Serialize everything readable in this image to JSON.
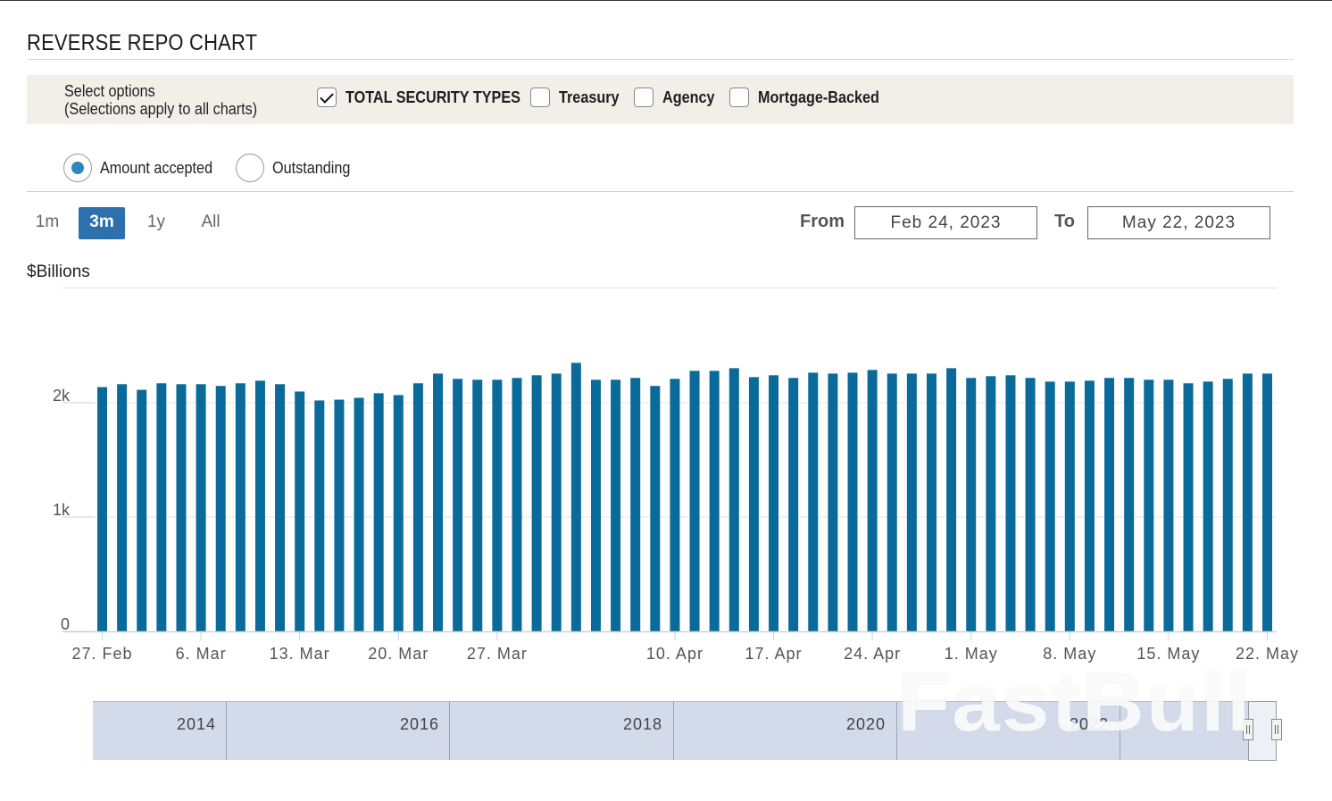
{
  "page": {
    "title": "REVERSE REPO CHART"
  },
  "options": {
    "label_line1": "Select options",
    "label_line2": "(Selections apply to all charts)",
    "checkboxes": [
      {
        "label": "TOTAL SECURITY TYPES",
        "checked": true
      },
      {
        "label": "Treasury",
        "checked": false
      },
      {
        "label": "Agency",
        "checked": false
      },
      {
        "label": "Mortgage-Backed",
        "checked": false
      }
    ]
  },
  "radios": [
    {
      "label": "Amount accepted",
      "selected": true
    },
    {
      "label": "Outstanding",
      "selected": false
    }
  ],
  "range": {
    "buttons": [
      {
        "label": "1m",
        "active": false
      },
      {
        "label": "3m",
        "active": true
      },
      {
        "label": "1y",
        "active": false
      },
      {
        "label": "All",
        "active": false
      }
    ],
    "from_label": "From",
    "from_value": "Feb 24, 2023",
    "to_label": "To",
    "to_value": "May 22, 2023"
  },
  "navigator": {
    "years": [
      "2014",
      "2016",
      "2018",
      "2020",
      "2022"
    ]
  },
  "watermark": "FastBull",
  "colors": {
    "bar": "#0a6a9a",
    "active_button": "#2e6fad",
    "options_bg": "#f2efe9",
    "navigator_bg": "#d3dae9"
  },
  "chart_data": {
    "type": "bar",
    "ylabel": "$Billions",
    "ylim": [
      0,
      2500
    ],
    "yticks": [
      {
        "value": 0,
        "label": "0"
      },
      {
        "value": 1000,
        "label": "1k"
      },
      {
        "value": 2000,
        "label": "2k"
      }
    ],
    "xticks": [
      "27. Feb",
      "6. Mar",
      "13. Mar",
      "20. Mar",
      "27. Mar",
      "10. Apr",
      "17. Apr",
      "24. Apr",
      "1. May",
      "8. May",
      "15. May",
      "22. May"
    ],
    "xtick_bar_index": [
      0,
      5,
      10,
      15,
      20,
      29,
      34,
      39,
      44,
      49,
      54,
      59
    ],
    "series": [
      {
        "values": [
          2137,
          2162,
          2113,
          2170,
          2162,
          2162,
          2147,
          2170,
          2193,
          2162,
          2098,
          2020,
          2027,
          2043,
          2083,
          2067,
          2170,
          2255,
          2209,
          2201,
          2201,
          2217,
          2240,
          2255,
          2349,
          2201,
          2201,
          2217,
          2147,
          2209,
          2279,
          2279,
          2302,
          2224,
          2240,
          2217,
          2263,
          2255,
          2263,
          2287,
          2255,
          2255,
          2255,
          2302,
          2217,
          2232,
          2240,
          2217,
          2185,
          2185,
          2193,
          2217,
          2217,
          2201,
          2201,
          2170,
          2185,
          2209,
          2255,
          2255
        ]
      }
    ]
  }
}
